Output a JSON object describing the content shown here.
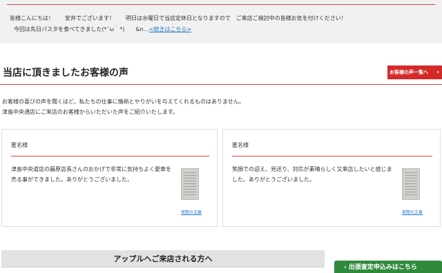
{
  "blog": {
    "line1": "皆様こんにちは！　　安井でございます！　　明日は水曜日で当店定休日となりますので　ご来店ご検討中の皆様お気を付けください！",
    "line2": "今回は先日パスタを食べてきました(*´ω｀*)　　&n…",
    "more_link": "<続きはこちら>"
  },
  "section": {
    "title": "当店に頂きましたお客様の声",
    "list_button": "お客様の声一覧へ",
    "list_button_arrow": "▸",
    "intro_lines": [
      "お客様の喜びの声を聞くほど、私たちの仕事に情熱とやりがいを与えてくれるものはありません。",
      "津島中央通店にご来店のお客様からいただいた声をご紹介いたします。"
    ]
  },
  "testimonials": [
    {
      "name": "匿名様",
      "text": "津島中央道店の藤原店長さんのおかげで非常に気持ちよく愛車を売る事ができました。ありがとうございました。",
      "link": "実際の文章"
    },
    {
      "name": "匿名様",
      "text": "笑顔での迎え、見送り、対応が素晴らしく又来店したいと感じました。ありがとうございました。",
      "link": "実際の文章"
    }
  ],
  "access": {
    "title": "アップルへご来店される方へ"
  },
  "cta": {
    "label": "› 出張査定申込みはこちら"
  },
  "colors": {
    "accent_red": "#d42a2a",
    "rule_red": "#d9453f",
    "link_blue": "#1a73c8",
    "cta_green": "#2f8a3c"
  }
}
